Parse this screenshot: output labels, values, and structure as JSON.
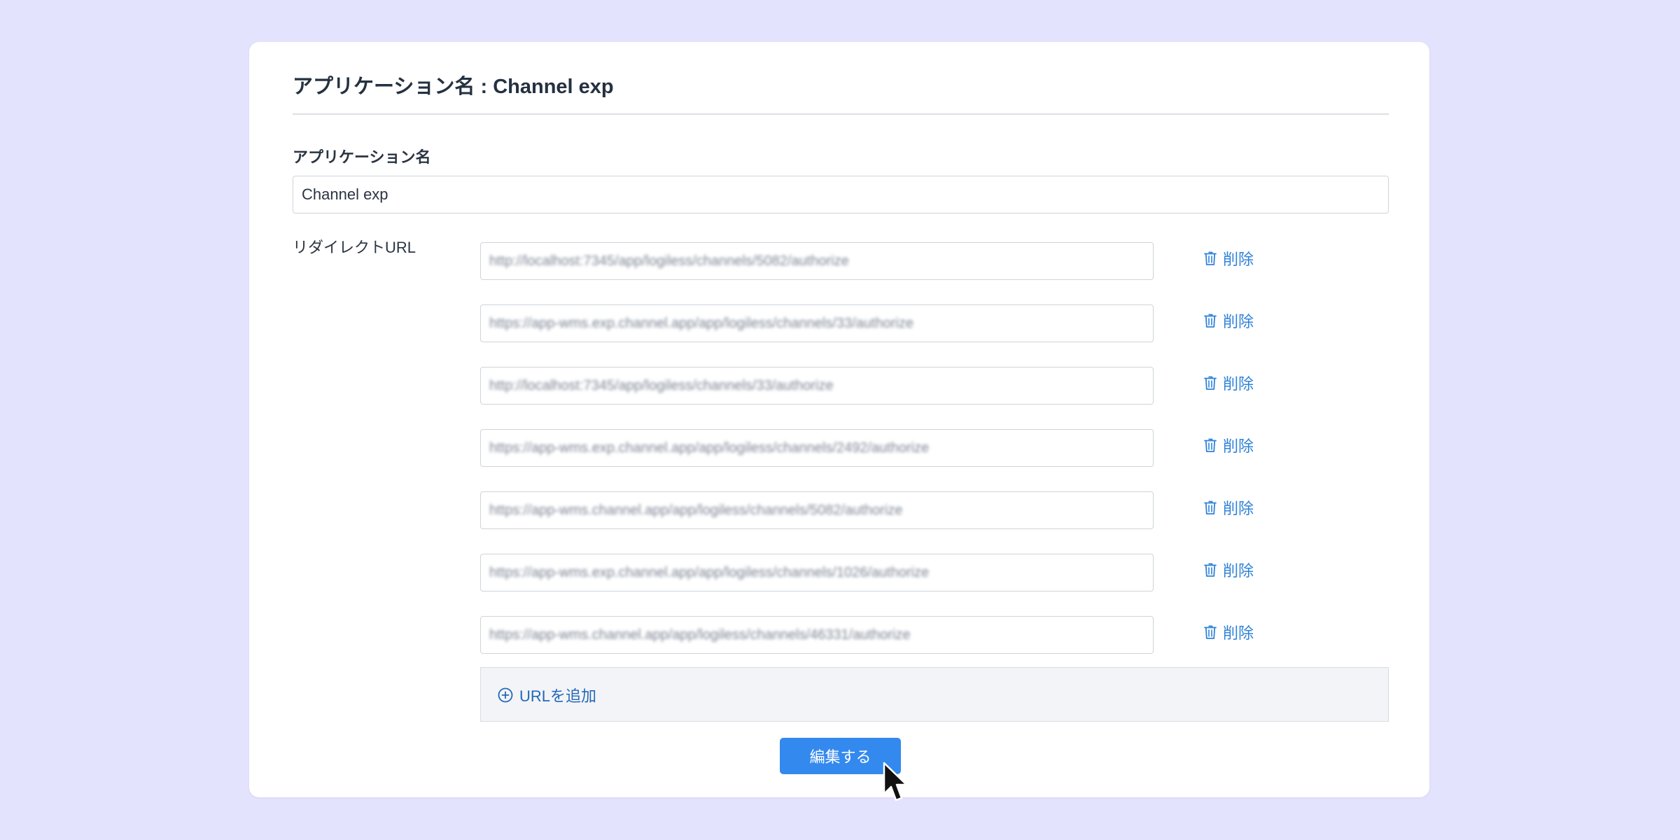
{
  "app_form": {
    "title_prefix": "アプリケーション名",
    "title_separator": " : ",
    "app_name": "Channel exp",
    "name_label": "アプリケーション名",
    "name_value": "Channel exp",
    "redirect_label": "リダイレクトURL",
    "redirect_urls": [
      "http://localhost:7345/app/logiless/channels/5082/authorize",
      "https://app-wms.exp.channel.app/app/logiless/channels/33/authorize",
      "http://localhost:7345/app/logiless/channels/33/authorize",
      "https://app-wms.exp.channel.app/app/logiless/channels/2492/authorize",
      "https://app-wms.channel.app/app/logiless/channels/5082/authorize",
      "https://app-wms.exp.channel.app/app/logiless/channels/1026/authorize",
      "https://app-wms.channel.app/app/logiless/channels/46331/authorize"
    ],
    "delete_label": "削除",
    "add_url_label": "URLを追加",
    "submit_label": "編集する"
  },
  "colors": {
    "background": "#e4e3fd",
    "accent": "#3389ee",
    "link": "#2f82d8"
  },
  "icons": {
    "delete": "trash-icon",
    "add": "plus-circle-icon",
    "cursor": "mouse-pointer-icon"
  }
}
